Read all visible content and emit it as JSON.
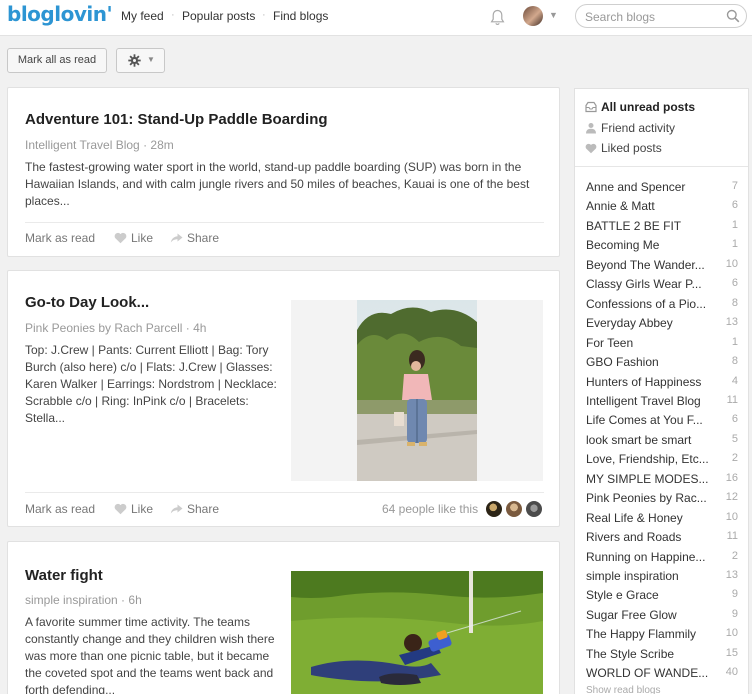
{
  "header": {
    "logo": "bloglovin'",
    "nav": [
      "My feed",
      "Popular posts",
      "Find blogs"
    ],
    "search_placeholder": "Search blogs"
  },
  "toolbar": {
    "mark_all": "Mark all as read"
  },
  "posts": [
    {
      "title": "Adventure 101: Stand-Up Paddle Boarding",
      "blog": "Intelligent Travel Blog",
      "age": "28m",
      "excerpt": "The fastest-growing water sport in the world, stand-up paddle boarding (SUP) was born in the Hawaiian Islands, and with calm jungle rivers and 50 miles of beaches, Kauai is one of the best places...",
      "mark_read": "Mark as read",
      "like": "Like",
      "share": "Share"
    },
    {
      "title": "Go-to Day Look...",
      "blog": "Pink Peonies by Rach Parcell",
      "age": "4h",
      "excerpt": "Top: J.Crew | Pants: Current Elliott | Bag: Tory Burch (also here) c/o | Flats: J.Crew | Glasses: Karen Walker | Earrings: Nordstrom | Necklace: Scrabble c/o | Ring: InPink c/o | Bracelets: Stella...",
      "mark_read": "Mark as read",
      "like": "Like",
      "share": "Share",
      "likers": "64 people like this"
    },
    {
      "title": "Water fight",
      "blog": "simple inspiration",
      "age": "6h",
      "excerpt": "A favorite summer time activity. The teams constantly change and they children wish there was more than one picnic table, but it became the coveted spot and the teams went back and forth defending..."
    }
  ],
  "sidebar": {
    "filters": [
      "All unread posts",
      "Friend activity",
      "Liked posts"
    ],
    "blogs": [
      {
        "name": "Anne and Spencer",
        "count": "7"
      },
      {
        "name": "Annie & Matt",
        "count": "6"
      },
      {
        "name": "BATTLE 2 BE FIT",
        "count": "1"
      },
      {
        "name": "Becoming Me",
        "count": "1"
      },
      {
        "name": "Beyond The Wander...",
        "count": "10"
      },
      {
        "name": "Classy Girls Wear P...",
        "count": "6"
      },
      {
        "name": "Confessions of a Pio...",
        "count": "8"
      },
      {
        "name": "Everyday Abbey",
        "count": "13"
      },
      {
        "name": "For Teen",
        "count": "1"
      },
      {
        "name": "GBO Fashion",
        "count": "8"
      },
      {
        "name": "Hunters of Happiness",
        "count": "4"
      },
      {
        "name": "Intelligent Travel Blog",
        "count": "11"
      },
      {
        "name": "Life Comes at You F...",
        "count": "6"
      },
      {
        "name": "look smart be smart",
        "count": "5"
      },
      {
        "name": "Love, Friendship, Etc...",
        "count": "2"
      },
      {
        "name": "MY SIMPLE MODES...",
        "count": "16"
      },
      {
        "name": "Pink Peonies by Rac...",
        "count": "12"
      },
      {
        "name": "Real Life & Honey",
        "count": "10"
      },
      {
        "name": "Rivers and Roads",
        "count": "11"
      },
      {
        "name": "Running on Happine...",
        "count": "2"
      },
      {
        "name": "simple inspiration",
        "count": "13"
      },
      {
        "name": "Style e Grace",
        "count": "9"
      },
      {
        "name": "Sugar Free Glow",
        "count": "9"
      },
      {
        "name": "The Happy Flammily",
        "count": "10"
      },
      {
        "name": "The Style Scribe",
        "count": "15"
      },
      {
        "name": "WORLD OF WANDE...",
        "count": "40"
      }
    ],
    "show_read": "Show read blogs"
  },
  "colors": {
    "brand": "#2d95d3"
  },
  "icons": [
    "bell-icon",
    "search-icon",
    "gear-icon",
    "heart-icon",
    "share-icon",
    "inbox-icon",
    "person-icon"
  ]
}
